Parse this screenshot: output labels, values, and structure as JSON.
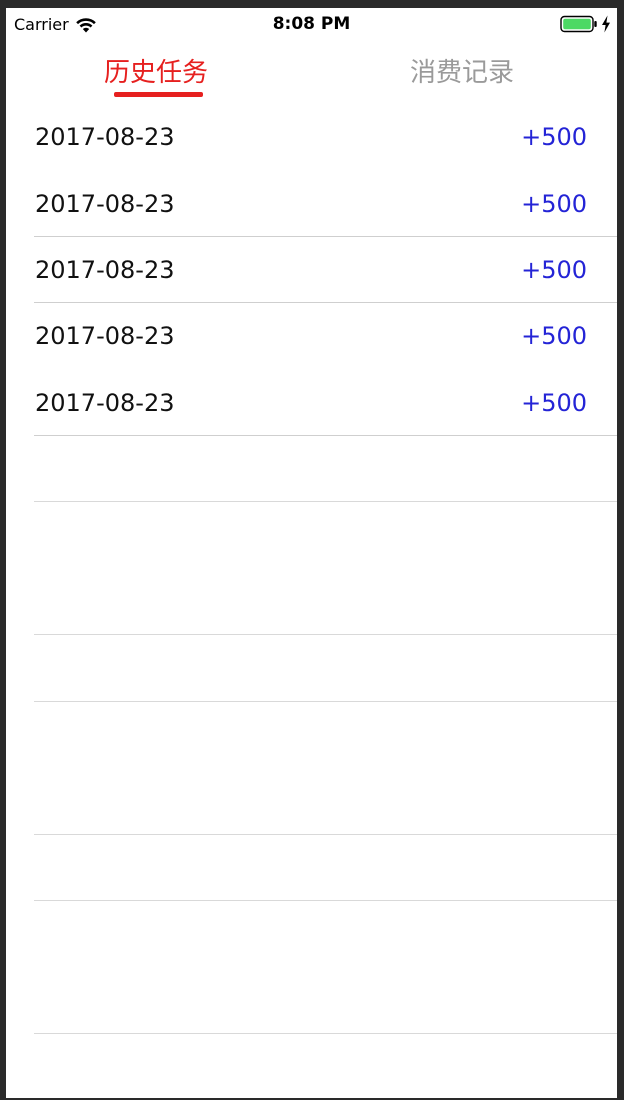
{
  "status_bar": {
    "carrier": "Carrier",
    "time": "8:08 PM"
  },
  "tabs": [
    {
      "label": "历史任务",
      "active": true
    },
    {
      "label": "消费记录",
      "active": false
    }
  ],
  "colors": {
    "active_tab": "#e6201f",
    "inactive_tab": "#9a9a9a",
    "amount": "#2424d6",
    "battery": "#4cd964"
  },
  "records": [
    {
      "date": "2017-08-23",
      "amount": "+500"
    },
    {
      "date": "2017-08-23",
      "amount": "+500"
    },
    {
      "date": "2017-08-23",
      "amount": "+500"
    },
    {
      "date": "2017-08-23",
      "amount": "+500"
    },
    {
      "date": "2017-08-23",
      "amount": "+500"
    }
  ]
}
